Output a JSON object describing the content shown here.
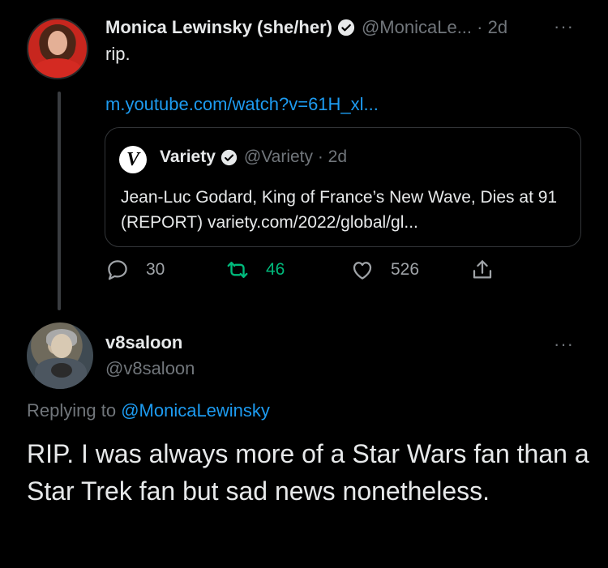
{
  "tweet1": {
    "name": "Monica Lewinsky (she/her)",
    "handle": "@MonicaLe... · 2d",
    "more": "···",
    "text": "rip.",
    "link": "m.youtube.com/watch?v=61H_xl...",
    "quote": {
      "logo_letter": "V",
      "name": "Variety",
      "handle": "@Variety · 2d",
      "text": "Jean-Luc Godard, King of France’s New Wave, Dies at 91 (REPORT) variety.com/2022/global/gl..."
    },
    "actions": {
      "replies": "30",
      "retweets": "46",
      "likes": "526"
    }
  },
  "tweet2": {
    "name": "v8saloon",
    "handle": "@v8saloon",
    "more": "···",
    "replying_prefix": "Replying to ",
    "replying_handle": "@MonicaLewinsky",
    "text": "RIP. I was always more of a Star Wars fan than a Star Trek fan but sad news nonetheless."
  },
  "colors": {
    "background": "#000000",
    "text": "#e7e9ea",
    "muted": "#71767b",
    "link": "#1d9bf0",
    "retweet_green": "#00ba7c"
  },
  "icons": [
    "verified-badge-icon",
    "reply-icon",
    "retweet-icon",
    "like-icon",
    "share-icon",
    "more-icon"
  ]
}
